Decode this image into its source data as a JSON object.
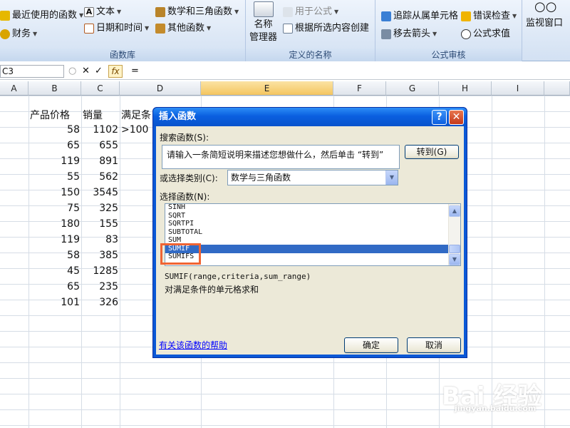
{
  "ribbon": {
    "function_library": {
      "items": [
        "最近使用的函数",
        "财务",
        "文本",
        "日期和时间",
        "数学和三角函数",
        "其他函数"
      ],
      "group_label": "函数库"
    },
    "defined_names": {
      "name_manager": [
        "名称",
        "管理器"
      ],
      "items": [
        "用于公式",
        "根据所选内容创建"
      ],
      "group_label": "定义的名称"
    },
    "formula_auditing": {
      "items": [
        "追踪从属单元格",
        "错误检查",
        "移去箭头",
        "公式求值"
      ],
      "group_label": "公式审核"
    },
    "watch_window": "监视窗口"
  },
  "formula_bar": {
    "name_box": "C3",
    "cancel": "✕",
    "enter": "✓",
    "fx": "fx",
    "content": "="
  },
  "columns": [
    "A",
    "B",
    "C",
    "D",
    "E",
    "F",
    "G",
    "H",
    "I"
  ],
  "sheet": {
    "headers": {
      "b": "产品价格",
      "c": "销量",
      "d": "满足条"
    },
    "d3": ">100",
    "rows": [
      {
        "price": "58",
        "qty": "1102"
      },
      {
        "price": "65",
        "qty": "655"
      },
      {
        "price": "119",
        "qty": "891"
      },
      {
        "price": "55",
        "qty": "562"
      },
      {
        "price": "150",
        "qty": "3545"
      },
      {
        "price": "75",
        "qty": "325"
      },
      {
        "price": "180",
        "qty": "155"
      },
      {
        "price": "119",
        "qty": "83"
      },
      {
        "price": "58",
        "qty": "385"
      },
      {
        "price": "45",
        "qty": "1285"
      },
      {
        "price": "65",
        "qty": "235"
      },
      {
        "price": "101",
        "qty": "326"
      }
    ]
  },
  "dialog": {
    "title": "插入函数",
    "help_btn": "?",
    "close_btn": "✕",
    "search_label": "搜索函数(S):",
    "search_text": "请输入一条简短说明来描述您想做什么，然后单击 “转到”",
    "go_button": "转到(G)",
    "category_label": "或选择类别(C):",
    "category_value": "数学与三角函数",
    "functions_label": "选择函数(N):",
    "functions": [
      "SINH",
      "SQRT",
      "SQRTPI",
      "SUBTOTAL",
      "SUM",
      "SUMIF",
      "SUMIFS"
    ],
    "selected_function": "SUMIF",
    "signature": "SUMIF(range,criteria,sum_range)",
    "description": "对满足条件的单元格求和",
    "help_link": "有关该函数的帮助",
    "ok": "确定",
    "cancel": "取消"
  },
  "watermark": {
    "brand": "Bai 经验",
    "url": "jingyan.baidu.com"
  },
  "colors": {
    "title_bar": "#0a5fe0",
    "highlight": "#f06433",
    "selection": "#316ac5",
    "dialog_bg": "#ece9d8"
  }
}
